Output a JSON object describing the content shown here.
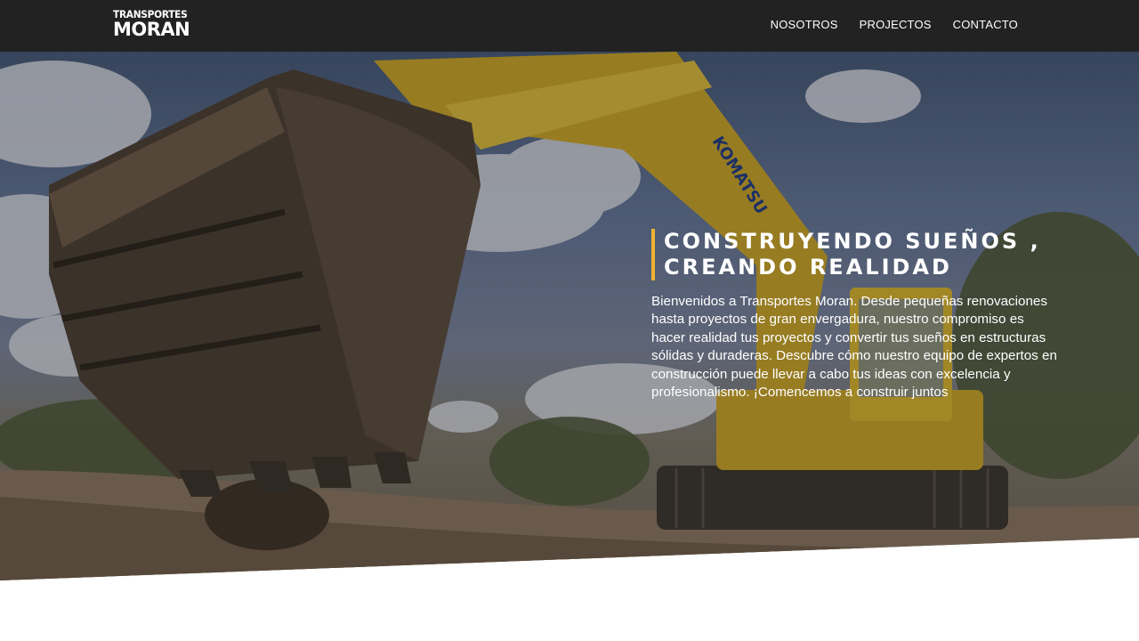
{
  "header": {
    "logo_line1": "TRANSPORTES",
    "logo_line2": "MORAN",
    "nav": [
      "NOSOTROS",
      "PROJECTOS",
      "CONTACTO"
    ]
  },
  "hero": {
    "headline_line1": "CONSTRUYENDO SUEÑOS ,",
    "headline_line2": "CREANDO REALIDAD",
    "intro": "Bienvenidos a Transportes Moran. Desde pequeñas renovaciones hasta proyectos de gran envergadura, nuestro compromiso es hacer realidad tus proyectos y convertir tus sueños en estructuras sólidas y duraderas. Descubre cómo nuestro equipo de expertos en construcción puede llevar a cabo tus ideas con excelencia y profesionalismo. ¡Comencemos a construir juntos",
    "machine_brand": "KOMATSU",
    "accent_color": "#f0b233"
  }
}
